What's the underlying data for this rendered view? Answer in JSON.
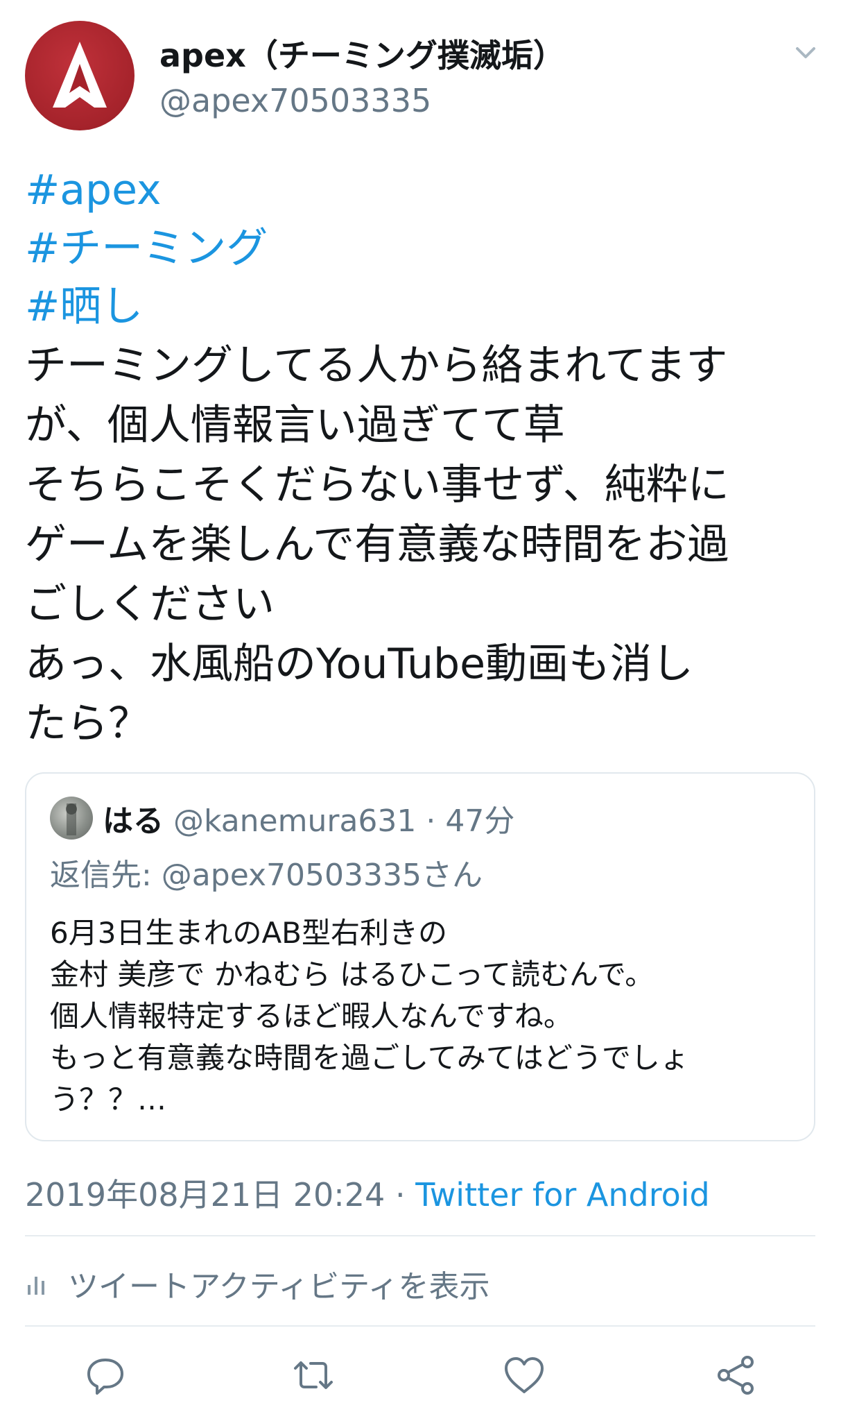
{
  "author": {
    "display_name": "apex（チーミング撲滅垢）",
    "handle": "@apex70503335",
    "avatar_icon": "apex-logo-icon",
    "avatar_color": "#a5232b"
  },
  "tweet": {
    "hashtags": [
      "#apex",
      "#チーミング",
      "#晒し"
    ],
    "lines": [
      "チーミングしてる人から絡まれてます",
      "が、個人情報言い過ぎてて草",
      "そちらこそくだらない事せず、純粋に",
      "ゲームを楽しんで有意義な時間をお過",
      "ごしください",
      "あっ、水風船のYouTube動画も消し",
      "たら？"
    ]
  },
  "quoted_tweet": {
    "name": "はる",
    "handle": "@kanemura631",
    "separator": "·",
    "time_ago": "47分",
    "reply_to": "返信先: @apex70503335さん",
    "lines": [
      "6月3日生まれのAB型右利きの",
      "金村 美彦で かねむら はるひこって読むんで。",
      "個人情報特定するほど暇人なんですね。",
      "もっと有意義な時間を過ごしてみてはどうでしょ",
      "う？？…"
    ]
  },
  "meta": {
    "datetime": "2019年08月21日 20:24",
    "separator": "·",
    "source": "Twitter for Android"
  },
  "activity": {
    "label": "ツイートアクティビティを表示",
    "icon": "bar-chart-icon"
  },
  "actions": {
    "reply_icon": "reply-icon",
    "retweet_icon": "retweet-icon",
    "like_icon": "heart-icon",
    "share_icon": "share-icon"
  },
  "colors": {
    "link": "#1b95e0",
    "secondary_text": "#657786",
    "primary_text": "#14171a",
    "border": "#e1e8ed"
  }
}
